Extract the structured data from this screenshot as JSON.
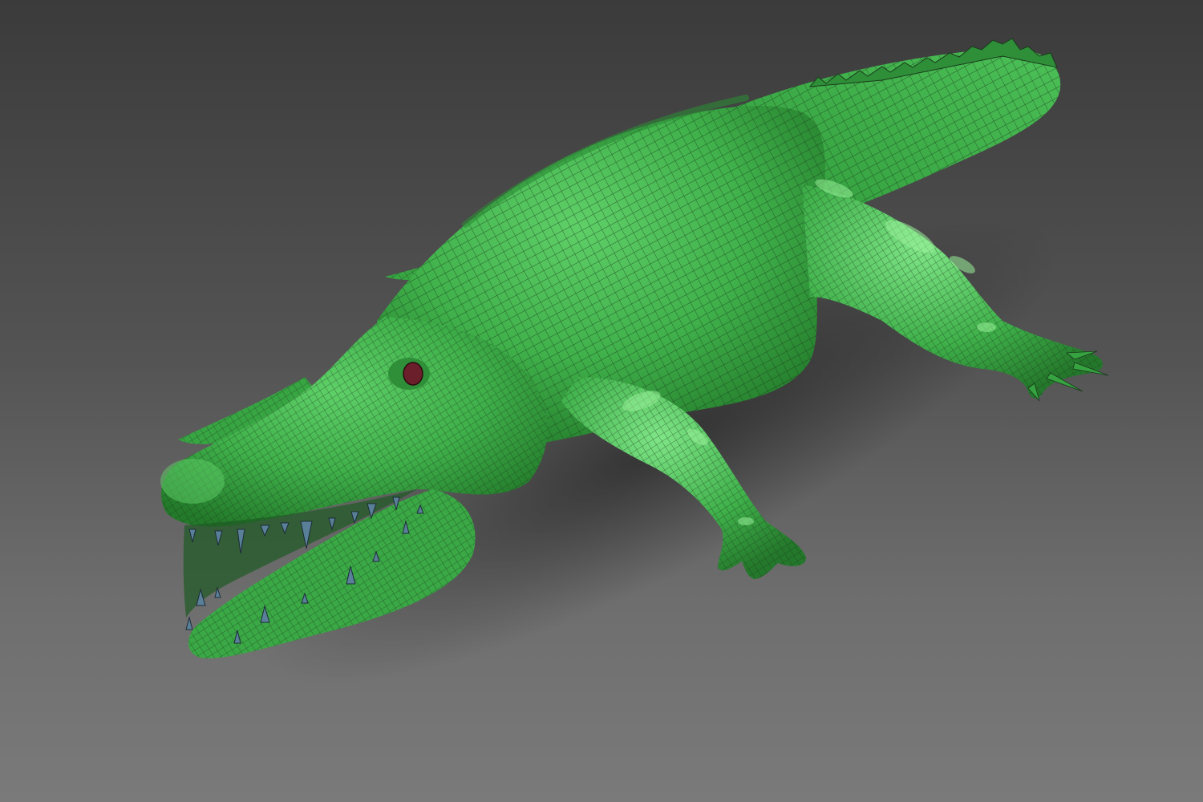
{
  "scene": {
    "subject": "crocodile-mesh",
    "colors": {
      "background_top": "#3b3b3b",
      "background_bottom": "#7a7a7a",
      "skin": "#3fb04a",
      "skin_highlight": "#9af09a",
      "skin_shadow": "#1f6a26",
      "wire": "#1a3a1c",
      "teeth": "#5a7f99",
      "eye": "#6a1f2a"
    },
    "wireframe": true
  }
}
